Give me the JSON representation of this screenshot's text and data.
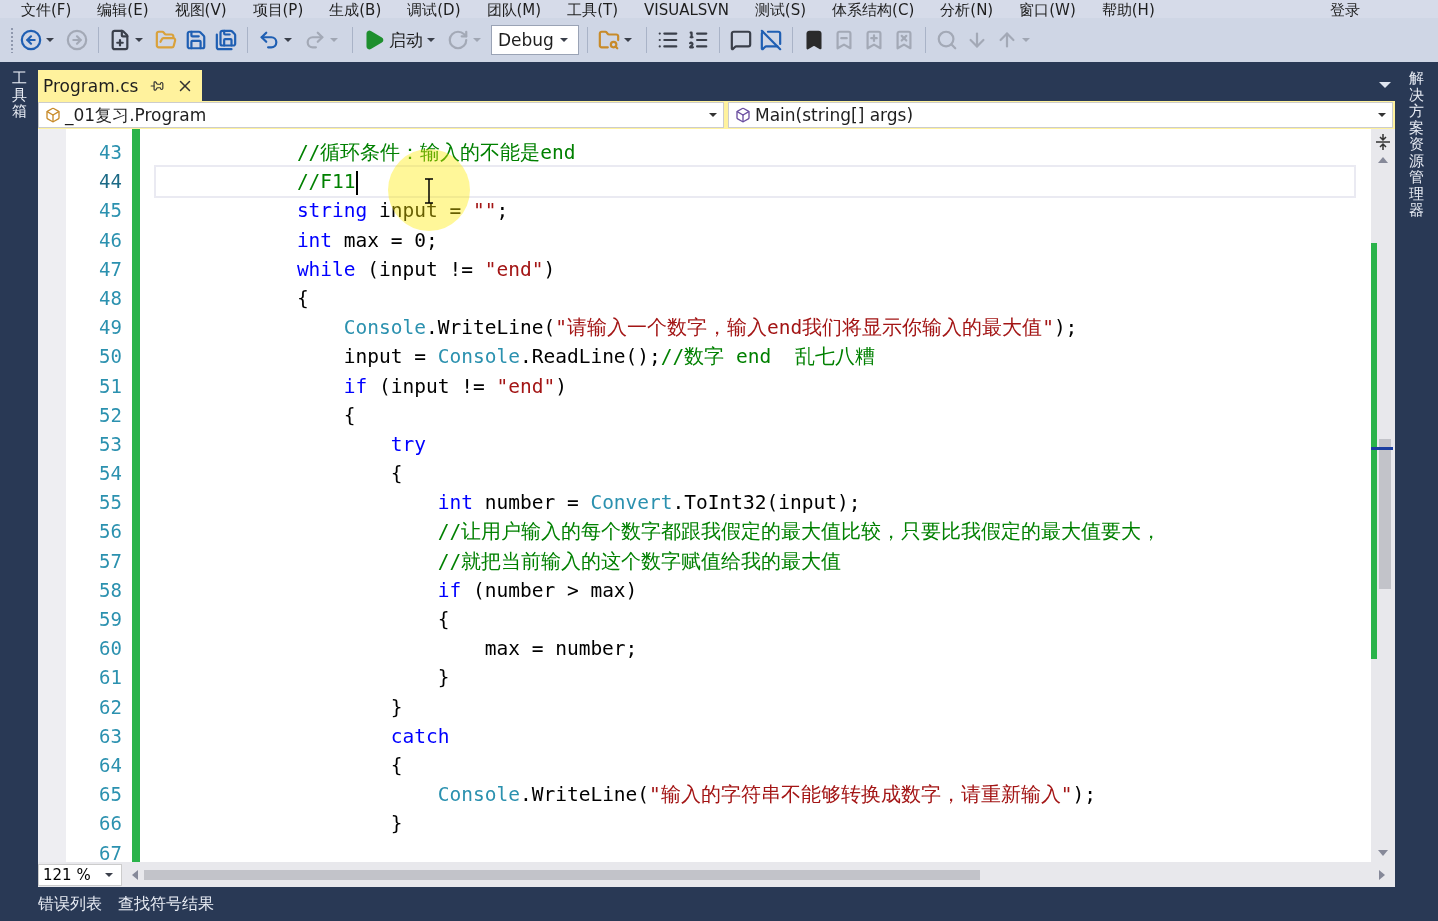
{
  "menu": [
    "文件(F)",
    "编辑(E)",
    "视图(V)",
    "项目(P)",
    "生成(B)",
    "调试(D)",
    "团队(M)",
    "工具(T)",
    "VISUALSVN",
    "测试(S)",
    "体系结构(C)",
    "分析(N)",
    "窗口(W)",
    "帮助(H)"
  ],
  "sign_in": "登录",
  "toolbar": [
    {
      "kind": "back",
      "disabled": false,
      "dropdown": true
    },
    {
      "kind": "forward",
      "disabled": true,
      "dropdown": false
    },
    {
      "kind": "sep"
    },
    {
      "kind": "new",
      "disabled": false,
      "dropdown": true
    },
    {
      "kind": "open",
      "disabled": false,
      "dropdown": false
    },
    {
      "kind": "save",
      "disabled": false,
      "dropdown": false
    },
    {
      "kind": "saveall",
      "disabled": false,
      "dropdown": false
    },
    {
      "kind": "sep"
    },
    {
      "kind": "undo",
      "disabled": false,
      "dropdown": true
    },
    {
      "kind": "redo",
      "disabled": true,
      "dropdown": true
    },
    {
      "kind": "sep"
    },
    {
      "kind": "start",
      "disabled": false,
      "dropdown": true,
      "label": "启动"
    },
    {
      "kind": "restart",
      "disabled": true,
      "dropdown": true
    },
    {
      "kind": "config",
      "value": "Debug"
    },
    {
      "kind": "sep"
    },
    {
      "kind": "find",
      "disabled": false,
      "dropdown": true
    },
    {
      "kind": "sep"
    },
    {
      "kind": "stepin",
      "disabled": false,
      "dropdown": false
    },
    {
      "kind": "stepover",
      "disabled": false,
      "dropdown": false
    },
    {
      "kind": "sep"
    },
    {
      "kind": "comment",
      "disabled": false,
      "dropdown": false
    },
    {
      "kind": "uncomment",
      "disabled": false,
      "dropdown": false
    },
    {
      "kind": "sep"
    },
    {
      "kind": "bookmark",
      "disabled": false,
      "dropdown": false
    },
    {
      "kind": "prevmark",
      "disabled": true,
      "dropdown": false
    },
    {
      "kind": "nextmark",
      "disabled": true,
      "dropdown": false
    },
    {
      "kind": "clearmark",
      "disabled": true,
      "dropdown": false
    },
    {
      "kind": "sep"
    },
    {
      "kind": "search",
      "disabled": true,
      "dropdown": false
    },
    {
      "kind": "down",
      "disabled": true,
      "dropdown": false
    },
    {
      "kind": "up",
      "disabled": true,
      "dropdown": true
    }
  ],
  "left_panel": "工具箱",
  "right_panel": "解决方案资源管理器",
  "tabs": [
    {
      "label": "Program.cs",
      "selected": true
    }
  ],
  "nav": {
    "type": "_01复习.Program",
    "member": "Main(string[] args)"
  },
  "lines": [
    {
      "number": "43",
      "current": false,
      "tokens": [
        {
          "kind": "comment",
          "t": "            //循环条件：输入的不能是end"
        }
      ]
    },
    {
      "number": "44",
      "current": true,
      "tokens": [
        {
          "kind": "comment",
          "t": "            //F11"
        }
      ]
    },
    {
      "number": "45",
      "current": false,
      "tokens": [
        {
          "kind": "kw",
          "t": "            string"
        },
        {
          "kind": "plain",
          "t": " input = "
        },
        {
          "kind": "str",
          "t": "\"\""
        },
        {
          "kind": "plain",
          "t": ";"
        }
      ]
    },
    {
      "number": "46",
      "current": false,
      "tokens": [
        {
          "kind": "kw",
          "t": "            int"
        },
        {
          "kind": "plain",
          "t": " max = 0;"
        }
      ]
    },
    {
      "number": "47",
      "current": false,
      "tokens": [
        {
          "kind": "kw",
          "t": "            while"
        },
        {
          "kind": "plain",
          "t": " (input != "
        },
        {
          "kind": "str",
          "t": "\"end\""
        },
        {
          "kind": "plain",
          "t": ")"
        }
      ]
    },
    {
      "number": "48",
      "current": false,
      "tokens": [
        {
          "kind": "plain",
          "t": "            {"
        }
      ]
    },
    {
      "number": "49",
      "current": false,
      "tokens": [
        {
          "kind": "type",
          "t": "                Console"
        },
        {
          "kind": "plain",
          "t": ".WriteLine("
        },
        {
          "kind": "str",
          "t": "\"请输入一个数字，输入end我们将显示你输入的最大值\""
        },
        {
          "kind": "plain",
          "t": ");"
        }
      ]
    },
    {
      "number": "50",
      "current": false,
      "tokens": [
        {
          "kind": "plain",
          "t": "                input = "
        },
        {
          "kind": "type",
          "t": "Console"
        },
        {
          "kind": "plain",
          "t": ".ReadLine();"
        },
        {
          "kind": "comment",
          "t": "//数字 end  乱七八糟"
        }
      ]
    },
    {
      "number": "51",
      "current": false,
      "tokens": [
        {
          "kind": "kw",
          "t": "                if"
        },
        {
          "kind": "plain",
          "t": " (input != "
        },
        {
          "kind": "str",
          "t": "\"end\""
        },
        {
          "kind": "plain",
          "t": ")"
        }
      ]
    },
    {
      "number": "52",
      "current": false,
      "tokens": [
        {
          "kind": "plain",
          "t": "                {"
        }
      ]
    },
    {
      "number": "53",
      "current": false,
      "tokens": [
        {
          "kind": "kw",
          "t": "                    try"
        }
      ]
    },
    {
      "number": "54",
      "current": false,
      "tokens": [
        {
          "kind": "plain",
          "t": "                    {"
        }
      ]
    },
    {
      "number": "55",
      "current": false,
      "tokens": [
        {
          "kind": "kw",
          "t": "                        int"
        },
        {
          "kind": "plain",
          "t": " number = "
        },
        {
          "kind": "type",
          "t": "Convert"
        },
        {
          "kind": "plain",
          "t": ".ToInt32(input);"
        }
      ]
    },
    {
      "number": "56",
      "current": false,
      "tokens": [
        {
          "kind": "comment",
          "t": "                        //让用户输入的每个数字都跟我假定的最大值比较，只要比我假定的最大值要大，"
        }
      ]
    },
    {
      "number": "57",
      "current": false,
      "tokens": [
        {
          "kind": "comment",
          "t": "                        //就把当前输入的这个数字赋值给我的最大值"
        }
      ]
    },
    {
      "number": "58",
      "current": false,
      "tokens": [
        {
          "kind": "kw",
          "t": "                        if"
        },
        {
          "kind": "plain",
          "t": " (number > max)"
        }
      ]
    },
    {
      "number": "59",
      "current": false,
      "tokens": [
        {
          "kind": "plain",
          "t": "                        {"
        }
      ]
    },
    {
      "number": "60",
      "current": false,
      "tokens": [
        {
          "kind": "plain",
          "t": "                            max = number;"
        }
      ]
    },
    {
      "number": "61",
      "current": false,
      "tokens": [
        {
          "kind": "plain",
          "t": "                        }"
        }
      ]
    },
    {
      "number": "62",
      "current": false,
      "tokens": [
        {
          "kind": "plain",
          "t": "                    }"
        }
      ]
    },
    {
      "number": "63",
      "current": false,
      "tokens": [
        {
          "kind": "kw",
          "t": "                    catch"
        }
      ]
    },
    {
      "number": "64",
      "current": false,
      "tokens": [
        {
          "kind": "plain",
          "t": "                    {"
        }
      ]
    },
    {
      "number": "65",
      "current": false,
      "tokens": [
        {
          "kind": "type",
          "t": "                        Console"
        },
        {
          "kind": "plain",
          "t": ".WriteLine("
        },
        {
          "kind": "str",
          "t": "\"输入的字符串不能够转换成数字，请重新输入\""
        },
        {
          "kind": "plain",
          "t": ");"
        }
      ]
    },
    {
      "number": "66",
      "current": false,
      "tokens": [
        {
          "kind": "plain",
          "t": "                    }"
        }
      ]
    },
    {
      "number": "67",
      "current": false
    }
  ],
  "zoom": "121 %",
  "bottom_tabs": [
    "错误列表",
    "查找符号结果"
  ]
}
